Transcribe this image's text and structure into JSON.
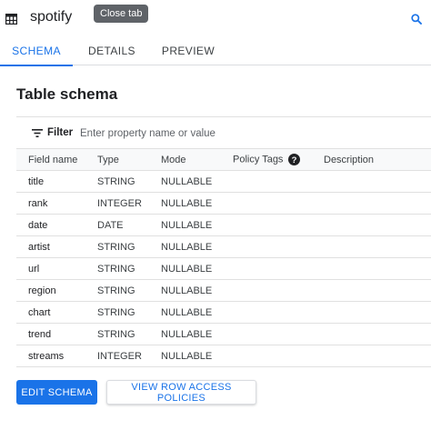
{
  "header": {
    "title": "spotify",
    "tooltip": "Close tab",
    "icons": {
      "table": "table-icon",
      "search": "search-icon"
    }
  },
  "tabs": [
    {
      "label": "SCHEMA",
      "active": true
    },
    {
      "label": "DETAILS",
      "active": false
    },
    {
      "label": "PREVIEW",
      "active": false
    }
  ],
  "schema": {
    "title": "Table schema",
    "filter": {
      "label": "Filter",
      "placeholder": "Enter property name or value",
      "value": ""
    },
    "columns": [
      "Field name",
      "Type",
      "Mode",
      "Policy Tags",
      "Description"
    ],
    "rows": [
      {
        "field": "title",
        "type": "STRING",
        "mode": "NULLABLE"
      },
      {
        "field": "rank",
        "type": "INTEGER",
        "mode": "NULLABLE"
      },
      {
        "field": "date",
        "type": "DATE",
        "mode": "NULLABLE"
      },
      {
        "field": "artist",
        "type": "STRING",
        "mode": "NULLABLE"
      },
      {
        "field": "url",
        "type": "STRING",
        "mode": "NULLABLE"
      },
      {
        "field": "region",
        "type": "STRING",
        "mode": "NULLABLE"
      },
      {
        "field": "chart",
        "type": "STRING",
        "mode": "NULLABLE"
      },
      {
        "field": "trend",
        "type": "STRING",
        "mode": "NULLABLE"
      },
      {
        "field": "streams",
        "type": "INTEGER",
        "mode": "NULLABLE"
      }
    ]
  },
  "actions": {
    "edit_schema": "EDIT SCHEMA",
    "view_row_access": "VIEW ROW ACCESS POLICIES"
  },
  "colors": {
    "accent": "#1a73e8",
    "tooltip_bg": "#5f6368",
    "divider": "#e0e0e0"
  }
}
